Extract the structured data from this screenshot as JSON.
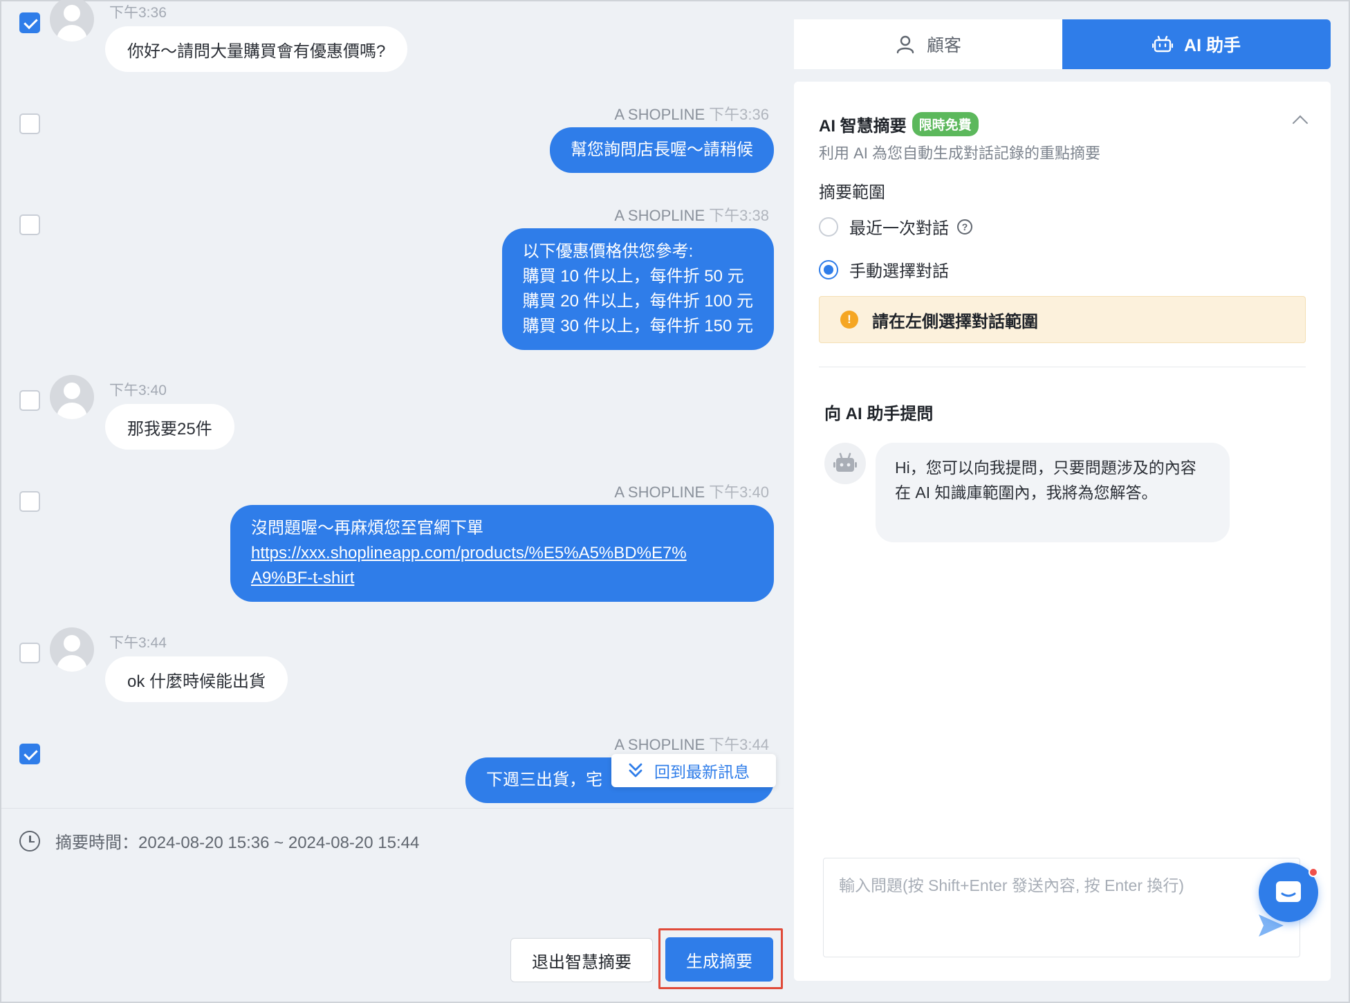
{
  "chat": {
    "messages": [
      {
        "dir": "in",
        "time": "下午3:36",
        "text": "你好～請問大量購買會有優惠價嗎?",
        "checked": true
      },
      {
        "dir": "out",
        "sender": "A SHOPLINE",
        "time": "下午3:36",
        "text": "幫您詢問店長喔～請稍候",
        "checked": false
      },
      {
        "dir": "out",
        "sender": "A SHOPLINE",
        "time": "下午3:38",
        "lines": [
          "以下優惠價格供您參考:",
          "購買 10 件以上，每件折 50 元",
          "購買 20 件以上，每件折 100 元",
          "購買 30 件以上，每件折 150 元"
        ],
        "checked": false
      },
      {
        "dir": "in",
        "time": "下午3:40",
        "text": "那我要25件",
        "checked": false
      },
      {
        "dir": "out",
        "sender": "A SHOPLINE",
        "time": "下午3:40",
        "text": "沒問題喔～再麻煩您至官網下單",
        "link_line1": "https://xxx.shoplineapp.com/products/%E5%A5%BD%E7%",
        "link_line2": "A9%BF-t-shirt",
        "checked": false
      },
      {
        "dir": "in",
        "time": "下午3:44",
        "text": "ok 什麼時候能出貨",
        "checked": false
      },
      {
        "dir": "out",
        "sender": "A SHOPLINE",
        "time": "下午3:44",
        "text": "下週三出貨，宅",
        "checked": true
      }
    ],
    "jump_label": "回到最新訊息",
    "summary_time": "摘要時間：2024-08-20 15:36 ~ 2024-08-20 15:44",
    "exit_button": "退出智慧摘要",
    "generate_button": "生成摘要"
  },
  "tabs": [
    {
      "label": "顧客",
      "icon": "person-icon",
      "active": false
    },
    {
      "label": "AI 助手",
      "icon": "robot-icon",
      "active": true
    }
  ],
  "ai": {
    "title": "AI 智慧摘要",
    "badge": "限時免費",
    "subtitle": "利用 AI 為您自動生成對話記錄的重點摘要",
    "range_label": "摘要範圍",
    "options": [
      {
        "label": "最近一次對話",
        "selected": false,
        "help": "?"
      },
      {
        "label": "手動選擇對話",
        "selected": true
      }
    ],
    "warning_icon": "!",
    "warning": "請在左側選擇對話範圍",
    "ask_title": "向 AI 助手提問",
    "bot_message": "Hi，您可以向我提問，只要問題涉及的內容在 AI 知識庫範圍內，我將為您解答。",
    "input_placeholder": "輸入問題(按 Shift+Enter 發送內容, 按 Enter 換行)"
  },
  "colors": {
    "primary": "#2f7de9",
    "badge_green": "#5cb85c",
    "warning_bg": "#fcf1dc",
    "highlight_red": "#e04b3a"
  }
}
